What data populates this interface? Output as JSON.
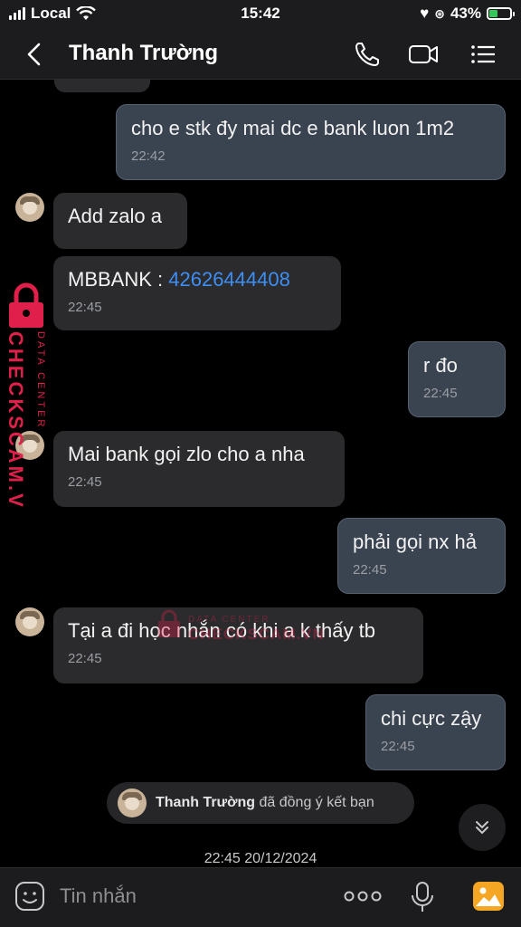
{
  "status_bar": {
    "carrier": "Local",
    "time": "15:42",
    "battery": "43%",
    "battery_level": 0.43
  },
  "header": {
    "title": "Thanh Trường"
  },
  "messages": [
    {
      "text": "cho e stk đy mai dc e bank luon 1m2",
      "time": "22:42"
    },
    {
      "text": "Add zalo a"
    },
    {
      "prefix": "MBBANK : ",
      "link": "42626444408",
      "time": "22:45"
    },
    {
      "text": "r đo",
      "time": "22:45"
    },
    {
      "text": "Mai bank gọi zlo cho a nha",
      "time": "22:45"
    },
    {
      "text": "phải gọi nx hả",
      "time": "22:45"
    },
    {
      "text": "Tại a đi học nhắn có khi a k thấy tb",
      "time": "22:45"
    },
    {
      "text": "chi cực zậy",
      "time": "22:45"
    }
  ],
  "system_note": {
    "name": "Thanh Trường",
    "text": " đã đồng ý kết bạn"
  },
  "date_separator": "22:45 20/12/2024",
  "input": {
    "placeholder": "Tin nhắn"
  },
  "watermark": {
    "brand": "CHECKSCAM.VN",
    "sub": "DATA CENTER"
  },
  "colors": {
    "link": "#3d8ef5",
    "image_button": "#f5a623",
    "watermark": "#e0204a"
  },
  "icons": {
    "back": "chevron-left-icon",
    "call": "phone-icon",
    "video": "video-camera-icon",
    "menu": "list-menu-icon",
    "scroll": "double-chevron-down-icon",
    "emoji": "emoji-icon",
    "more": "more-dots-icon",
    "mic": "microphone-icon",
    "image": "image-icon"
  }
}
